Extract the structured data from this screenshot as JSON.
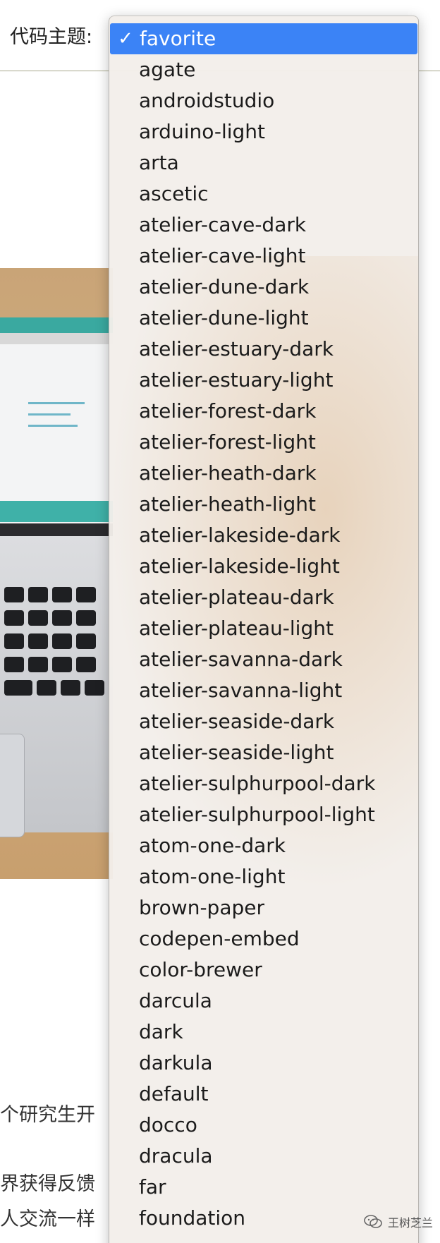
{
  "toolbar": {
    "theme_label": "代码主题:"
  },
  "article": {
    "line1": "个研究生开",
    "line2": "界获得反馈",
    "line3": "人交流一样"
  },
  "dropdown": {
    "selected_value": "favorite",
    "checkmark": "✓",
    "options": [
      "favorite",
      "agate",
      "androidstudio",
      "arduino-light",
      "arta",
      "ascetic",
      "atelier-cave-dark",
      "atelier-cave-light",
      "atelier-dune-dark",
      "atelier-dune-light",
      "atelier-estuary-dark",
      "atelier-estuary-light",
      "atelier-forest-dark",
      "atelier-forest-light",
      "atelier-heath-dark",
      "atelier-heath-light",
      "atelier-lakeside-dark",
      "atelier-lakeside-light",
      "atelier-plateau-dark",
      "atelier-plateau-light",
      "atelier-savanna-dark",
      "atelier-savanna-light",
      "atelier-seaside-dark",
      "atelier-seaside-light",
      "atelier-sulphurpool-dark",
      "atelier-sulphurpool-light",
      "atom-one-dark",
      "atom-one-light",
      "brown-paper",
      "codepen-embed",
      "color-brewer",
      "darcula",
      "dark",
      "darkula",
      "default",
      "docco",
      "dracula",
      "far",
      "foundation"
    ],
    "selected_color": "#3b83f6"
  },
  "watermark": {
    "icon": "wechat-icon",
    "text": "王树芝兰"
  }
}
